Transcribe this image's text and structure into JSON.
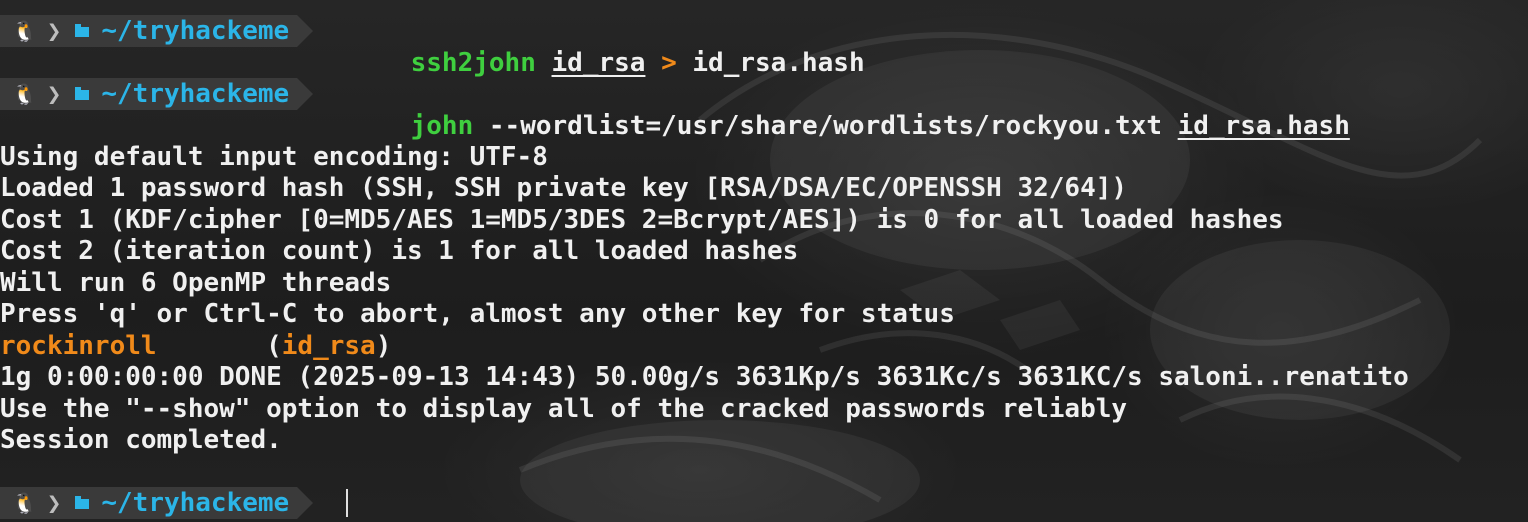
{
  "prompt": {
    "path": "~/tryhackeme",
    "os_icon": "linux-tux-icon",
    "separator_icon": "chevron-right-icon",
    "folder_icon": "folder-icon"
  },
  "commands": [
    {
      "program": "ssh2john",
      "arg1": "id_rsa",
      "redirect": ">",
      "arg2": "id_rsa.hash"
    },
    {
      "program": "john",
      "arg1": "--wordlist=/usr/share/wordlists/rockyou.txt",
      "arg2": "id_rsa.hash"
    }
  ],
  "output": [
    "Using default input encoding: UTF-8",
    "Loaded 1 password hash (SSH, SSH private key [RSA/DSA/EC/OPENSSH 32/64])",
    "Cost 1 (KDF/cipher [0=MD5/AES 1=MD5/3DES 2=Bcrypt/AES]) is 0 for all loaded hashes",
    "Cost 2 (iteration count) is 1 for all loaded hashes",
    "Will run 6 OpenMP threads",
    "Press 'q' or Ctrl-C to abort, almost any other key for status"
  ],
  "cracked": {
    "password": "rockinroll",
    "spacing": "       (",
    "file": "id_rsa",
    "close": ")"
  },
  "output2": [
    "1g 0:00:00:00 DONE (2025-09-13 14:43) 50.00g/s 3631Kp/s 3631Kc/s 3631KC/s saloni..renatito",
    "Use the \"--show\" option to display all of the cracked passwords reliably",
    "Session completed."
  ],
  "colors": {
    "path": "#2bb5e8",
    "program": "#3fcf3f",
    "redirect": "#f08a1a",
    "password": "#f08a1a",
    "text": "#f0f0f0",
    "background": "#1e1e1e"
  }
}
